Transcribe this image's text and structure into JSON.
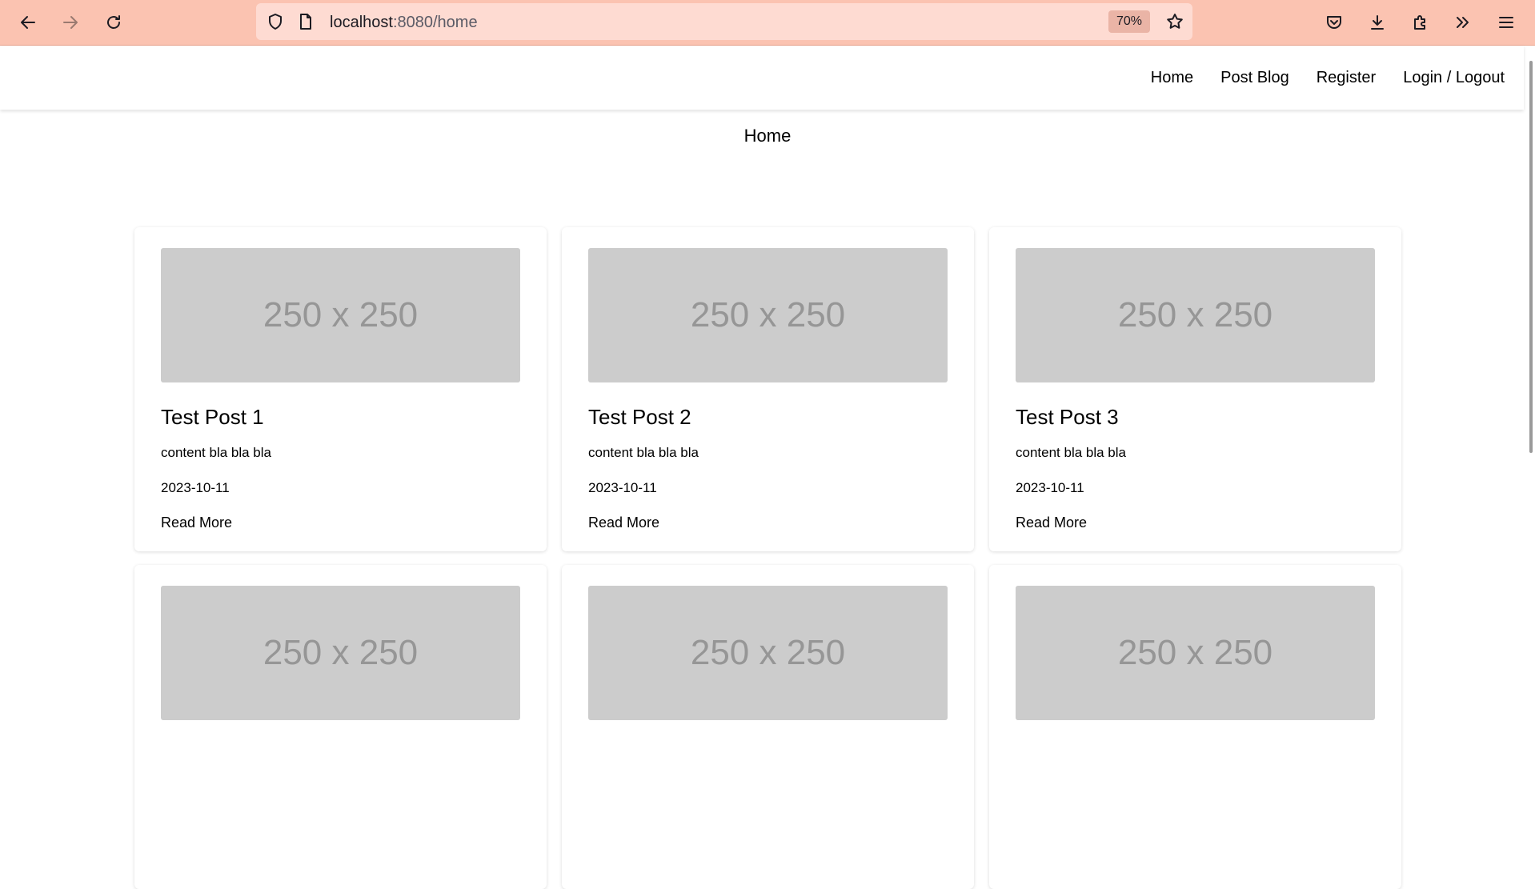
{
  "browser": {
    "url_host": "localhost",
    "url_path": ":8080/home",
    "zoom": "70%"
  },
  "nav": {
    "links": [
      "Home",
      "Post Blog",
      "Register",
      "Login / Logout"
    ]
  },
  "page": {
    "title": "Home"
  },
  "posts": [
    {
      "image_label": "250 x 250",
      "title": "Test Post 1",
      "content": "content bla bla bla",
      "date": "2023-10-11",
      "read_more": "Read More"
    },
    {
      "image_label": "250 x 250",
      "title": "Test Post 2",
      "content": "content bla bla bla",
      "date": "2023-10-11",
      "read_more": "Read More"
    },
    {
      "image_label": "250 x 250",
      "title": "Test Post 3",
      "content": "content bla bla bla",
      "date": "2023-10-11",
      "read_more": "Read More"
    },
    {
      "image_label": "250 x 250"
    },
    {
      "image_label": "250 x 250"
    },
    {
      "image_label": "250 x 250"
    }
  ]
}
